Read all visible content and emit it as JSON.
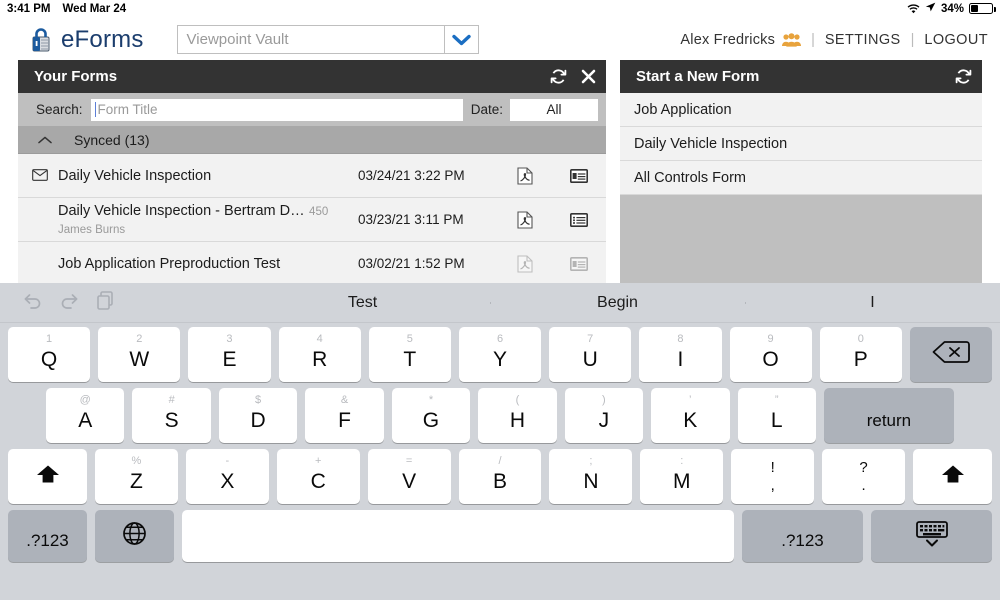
{
  "status_bar": {
    "time": "3:41 PM",
    "date": "Wed Mar 24",
    "battery_percent": "34%",
    "wifi_icon": "wifi-icon",
    "location_icon": "location-arrow-icon",
    "battery_icon": "battery-icon"
  },
  "header": {
    "logo_icon": "lock-icon",
    "brand": "eForms",
    "vault_value": "Viewpoint Vault",
    "vault_placeholder": "Viewpoint Vault",
    "dropdown_icon": "chevron-down-icon",
    "user_name": "Alex Fredricks",
    "users_icon": "users-group-icon",
    "separator": "|",
    "settings_label": "SETTINGS",
    "logout_label": "LOGOUT"
  },
  "your_forms": {
    "title": "Your Forms",
    "refresh_icon": "refresh-icon",
    "close_icon": "close-icon",
    "search_label": "Search:",
    "search_value": "",
    "search_placeholder": "Form Title",
    "date_label": "Date:",
    "date_value": "All",
    "group_label": "Synced (13)",
    "collapse_icon": "chevron-up-icon",
    "rows": [
      {
        "envelope_icon": "envelope-icon",
        "title": "Daily Vehicle Inspection",
        "meta_number": "",
        "meta_name": "",
        "date": "03/24/21 3:22 PM",
        "pdf_icon": "pdf-icon",
        "form_icon": "form-view-icon",
        "dimmed": false
      },
      {
        "envelope_icon": "",
        "title": "Daily Vehicle Inspection - Bertram D…",
        "meta_number": "450",
        "meta_name": "James  Burns",
        "date": "03/23/21 3:11 PM",
        "pdf_icon": "pdf-icon",
        "form_icon": "form-view-icon",
        "dimmed": false
      },
      {
        "envelope_icon": "",
        "title": "Job Application Preproduction Test",
        "meta_number": "",
        "meta_name": "",
        "date": "03/02/21 1:52 PM",
        "pdf_icon": "pdf-icon",
        "form_icon": "form-view-icon",
        "dimmed": true
      }
    ]
  },
  "new_form": {
    "title": "Start a New Form",
    "refresh_icon": "refresh-icon",
    "items": [
      {
        "label": "Job Application"
      },
      {
        "label": "Daily Vehicle Inspection"
      },
      {
        "label": "All Controls Form"
      }
    ]
  },
  "keyboard": {
    "undo_icon": "undo-icon",
    "redo_icon": "redo-icon",
    "paste_icon": "paste-icon",
    "suggestions": [
      "Test",
      "Begin",
      "I"
    ],
    "row1": [
      {
        "alt": "1",
        "main": "Q"
      },
      {
        "alt": "2",
        "main": "W"
      },
      {
        "alt": "3",
        "main": "E"
      },
      {
        "alt": "4",
        "main": "R"
      },
      {
        "alt": "5",
        "main": "T"
      },
      {
        "alt": "6",
        "main": "Y"
      },
      {
        "alt": "7",
        "main": "U"
      },
      {
        "alt": "8",
        "main": "I"
      },
      {
        "alt": "9",
        "main": "O"
      },
      {
        "alt": "0",
        "main": "P"
      }
    ],
    "backspace_icon": "backspace-icon",
    "row2": [
      {
        "alt": "@",
        "main": "A"
      },
      {
        "alt": "#",
        "main": "S"
      },
      {
        "alt": "$",
        "main": "D"
      },
      {
        "alt": "&",
        "main": "F"
      },
      {
        "alt": "*",
        "main": "G"
      },
      {
        "alt": "(",
        "main": "H"
      },
      {
        "alt": ")",
        "main": "J"
      },
      {
        "alt": "’",
        "main": "K"
      },
      {
        "alt": "”",
        "main": "L"
      }
    ],
    "return_label": "return",
    "shift_icon": "shift-icon",
    "row3": [
      {
        "alt": "%",
        "main": "Z"
      },
      {
        "alt": "-",
        "main": "X"
      },
      {
        "alt": "+",
        "main": "C"
      },
      {
        "alt": "=",
        "main": "V"
      },
      {
        "alt": "/",
        "main": "B"
      },
      {
        "alt": ";",
        "main": "N"
      },
      {
        "alt": ":",
        "main": "M"
      },
      {
        "alt": "!",
        "main": ","
      },
      {
        "alt": "?",
        "main": "."
      }
    ],
    "numeric_left_label": ".?123",
    "globe_icon": "globe-icon",
    "space_label": "",
    "numeric_right_label": ".?123",
    "dismiss_icon": "dismiss-keyboard-icon"
  },
  "colors": {
    "brand_blue": "#1b3d6d",
    "panel_header": "#333333",
    "panel_sub": "#bfbfbf",
    "group_header": "#a8a8a8",
    "keyboard_bg": "#d1d4d9",
    "key_gray": "#adb2ba",
    "caret_blue": "#5d7fd6",
    "users_orange": "#e8a33d"
  }
}
